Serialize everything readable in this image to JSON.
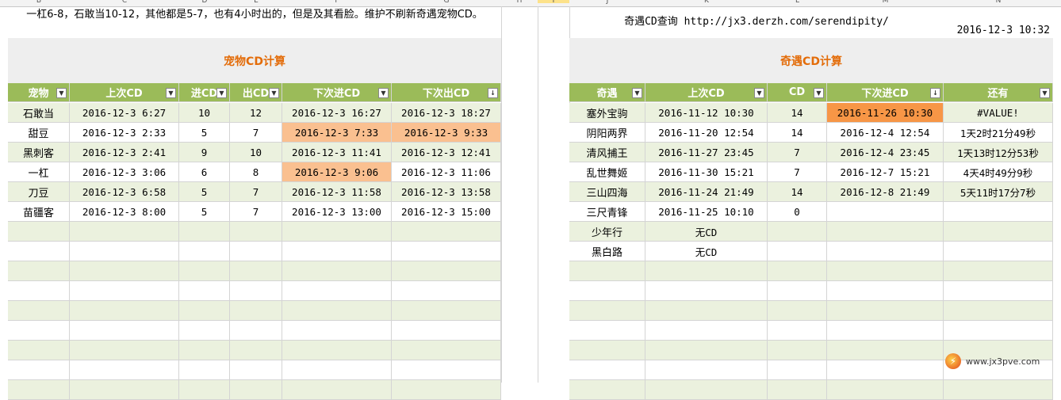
{
  "columns": [
    "B",
    "C",
    "D",
    "E",
    "F",
    "G",
    "H",
    "I",
    "J",
    "K",
    "L",
    "M",
    "N"
  ],
  "left": {
    "note": "一杠6-8，石敢当10-12，其他都是5-7，也有4小时出的，但是及其看脸。维护不刷新奇遇宠物CD。",
    "title": "宠物CD计算",
    "headers": [
      "宠物",
      "上次CD",
      "进CD",
      "出CD",
      "下次进CD",
      "下次出CD"
    ],
    "rows": [
      [
        "石敢当",
        "2016-12-3 6:27",
        "10",
        "12",
        "2016-12-3 16:27",
        "2016-12-3 18:27"
      ],
      [
        "甜豆",
        "2016-12-3 2:33",
        "5",
        "7",
        "2016-12-3 7:33",
        "2016-12-3 9:33"
      ],
      [
        "黑刺客",
        "2016-12-3 2:41",
        "9",
        "10",
        "2016-12-3 11:41",
        "2016-12-3 12:41"
      ],
      [
        "一杠",
        "2016-12-3 3:06",
        "6",
        "8",
        "2016-12-3 9:06",
        "2016-12-3 11:06"
      ],
      [
        "刀豆",
        "2016-12-3 6:58",
        "5",
        "7",
        "2016-12-3 11:58",
        "2016-12-3 13:58"
      ],
      [
        "苗疆客",
        "2016-12-3 8:00",
        "5",
        "7",
        "2016-12-3 13:00",
        "2016-12-3 15:00"
      ]
    ]
  },
  "right": {
    "query": "奇遇CD查询 http://jx3.derzh.com/serendipity/",
    "now": "2016-12-3 10:32",
    "title": "奇遇CD计算",
    "headers": [
      "奇遇",
      "上次CD",
      "CD",
      "下次进CD",
      "还有"
    ],
    "rows": [
      [
        "塞外宝驹",
        "2016-11-12 10:30",
        "14",
        "2016-11-26 10:30",
        "#VALUE!"
      ],
      [
        "阴阳两界",
        "2016-11-20 12:54",
        "14",
        "2016-12-4 12:54",
        "1天2时21分49秒"
      ],
      [
        "清风捕王",
        "2016-11-27 23:45",
        "7",
        "2016-12-4 23:45",
        "1天13时12分53秒"
      ],
      [
        "乱世舞姬",
        "2016-11-30 15:21",
        "7",
        "2016-12-7 15:21",
        "4天4时49分9秒"
      ],
      [
        "三山四海",
        "2016-11-24 21:49",
        "14",
        "2016-12-8 21:49",
        "5天11时17分7秒"
      ],
      [
        "三尺青锋",
        "2016-11-25 10:10",
        "0",
        "",
        ""
      ],
      [
        "少年行",
        "无CD",
        "",
        "",
        ""
      ],
      [
        "黑白路",
        "无CD",
        "",
        "",
        ""
      ]
    ]
  },
  "watermark": "www.jx3pve.com"
}
